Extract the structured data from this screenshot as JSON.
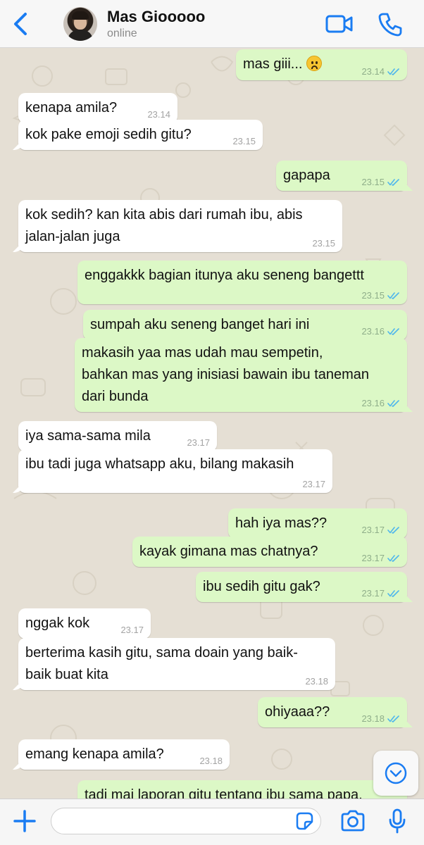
{
  "header": {
    "contact_name": "Mas Giooooo",
    "status": "online"
  },
  "messages": [
    {
      "side": "out",
      "text": "mas giii... ",
      "emoji": "sad-face",
      "time": "23.14",
      "read": true
    },
    {
      "side": "in",
      "text": "kenapa amila?",
      "time": "23.14"
    },
    {
      "side": "in",
      "text": "kok pake emoji sedih gitu?",
      "time": "23.15"
    },
    {
      "side": "out",
      "text": "gapapa",
      "time": "23.15",
      "read": true
    },
    {
      "side": "in",
      "text": "kok sedih? kan kita abis dari rumah ibu, abis\njalan-jalan juga",
      "time": "23.15"
    },
    {
      "side": "out",
      "text": "enggakkk bagian itunya aku seneng bangettt",
      "time": "23.15",
      "read": true
    },
    {
      "side": "out",
      "text": "sumpah aku seneng banget hari ini",
      "time": "23.16",
      "read": true
    },
    {
      "side": "out",
      "text": "makasih yaa mas udah mau sempetin,\nbahkan mas yang inisiasi bawain ibu taneman\ndari bunda",
      "time": "23.16",
      "read": true
    },
    {
      "side": "in",
      "text": "iya sama-sama mila",
      "time": "23.17"
    },
    {
      "side": "in",
      "text": "ibu tadi juga whatsapp aku, bilang makasih",
      "time": "23.17"
    },
    {
      "side": "out",
      "text": "hah iya mas??",
      "time": "23.17",
      "read": true
    },
    {
      "side": "out",
      "text": "kayak gimana mas chatnya?",
      "time": "23.17",
      "read": true
    },
    {
      "side": "out",
      "text": "ibu sedih gitu gak?",
      "time": "23.17",
      "read": true
    },
    {
      "side": "in",
      "text": "nggak kok",
      "time": "23.17"
    },
    {
      "side": "in",
      "text": "berterima kasih gitu, sama doain yang baik-\nbaik buat kita",
      "time": "23.18"
    },
    {
      "side": "out",
      "text": "ohiyaaa??",
      "time": "23.18",
      "read": true
    },
    {
      "side": "in",
      "text": "emang kenapa amila?",
      "time": "23.18"
    },
    {
      "side": "out",
      "text": "tadi mai laporan gitu tentang ibu sama papa.",
      "time": "",
      "read": false
    }
  ],
  "input": {
    "placeholder": "",
    "value": ""
  },
  "colors": {
    "accent": "#1a7cf2",
    "outgoing_bubble": "#dcf8c6",
    "incoming_bubble": "#ffffff",
    "read_ticks": "#4fb6ec",
    "wallpaper": "#e5dfd4"
  },
  "icons": {
    "back": "chevron-left-icon",
    "video": "video-call-icon",
    "call": "phone-icon",
    "scroll": "chevron-down-circle-icon",
    "add": "plus-icon",
    "sticker": "sticker-icon",
    "camera": "camera-icon",
    "mic": "microphone-icon"
  }
}
